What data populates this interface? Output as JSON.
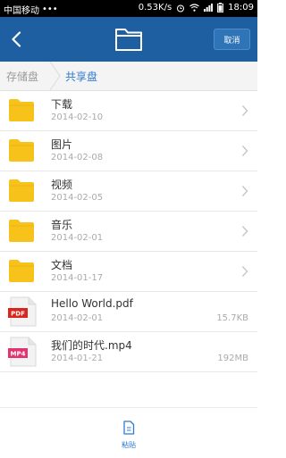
{
  "status_bar": {
    "carrier": "中国移动",
    "dots": "•••",
    "speed": "0.53K/s",
    "time": "18:09"
  },
  "header": {
    "cancel_label": "取消"
  },
  "breadcrumb": {
    "root": "存储盘",
    "current": "共享盘"
  },
  "items": [
    {
      "name": "下载",
      "date": "2014-02-10",
      "type": "folder"
    },
    {
      "name": "图片",
      "date": "2014-02-08",
      "type": "folder"
    },
    {
      "name": "视频",
      "date": "2014-02-05",
      "type": "folder"
    },
    {
      "name": "音乐",
      "date": "2014-02-01",
      "type": "folder"
    },
    {
      "name": "文档",
      "date": "2014-01-17",
      "type": "folder"
    },
    {
      "name": "Hello World.pdf",
      "date": "2014-02-01",
      "type": "file",
      "badge": "PDF",
      "badge_color": "#d9251d",
      "size": "15.7KB"
    },
    {
      "name": "我们的时代.mp4",
      "date": "2014-01-21",
      "type": "file",
      "badge": "MP4",
      "badge_color": "#e0336f",
      "size": "192MB"
    }
  ],
  "bottom_bar": {
    "paste_label": "粘贴"
  },
  "colors": {
    "title_bar": "#1d5fa1",
    "accent": "#2e7ad1",
    "folder": "#f7c21a"
  }
}
